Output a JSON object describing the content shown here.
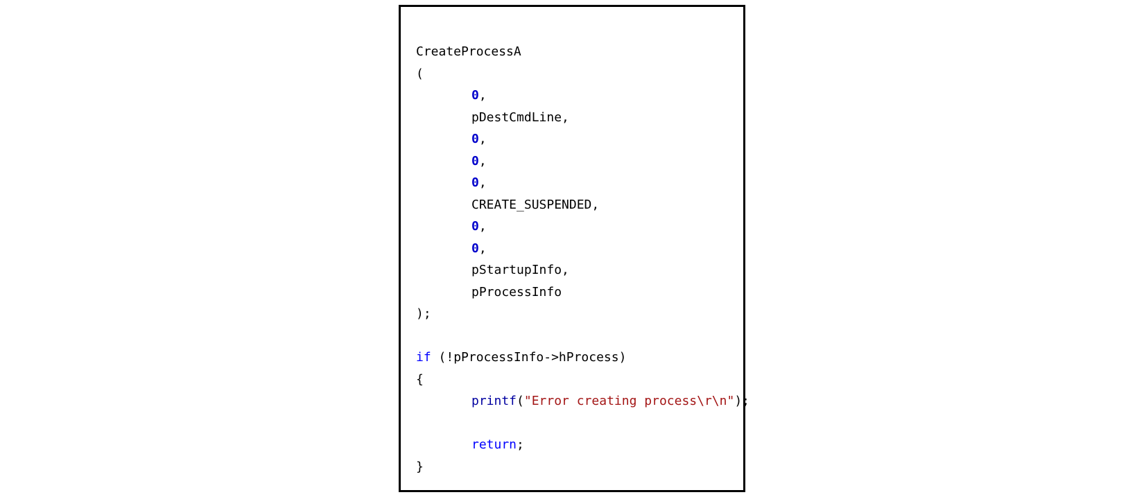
{
  "code": {
    "l1": "CreateProcessA",
    "l2": "(",
    "z": "0",
    "comma": ",",
    "arg2": "pDestCmdLine,",
    "arg6": "CREATE_SUSPENDED,",
    "arg9": "pStartupInfo,",
    "arg10": "pProcessInfo",
    "close": ");",
    "if_kw": "if",
    "if_cond": " (!pProcessInfo->hProcess)",
    "brace_open": "{",
    "printf": "printf",
    "printf_open": "(",
    "printf_arg": "\"Error creating process\\r\\n\"",
    "printf_close": ");",
    "return_kw": "return",
    "semicolon": ";",
    "brace_close": "}"
  }
}
